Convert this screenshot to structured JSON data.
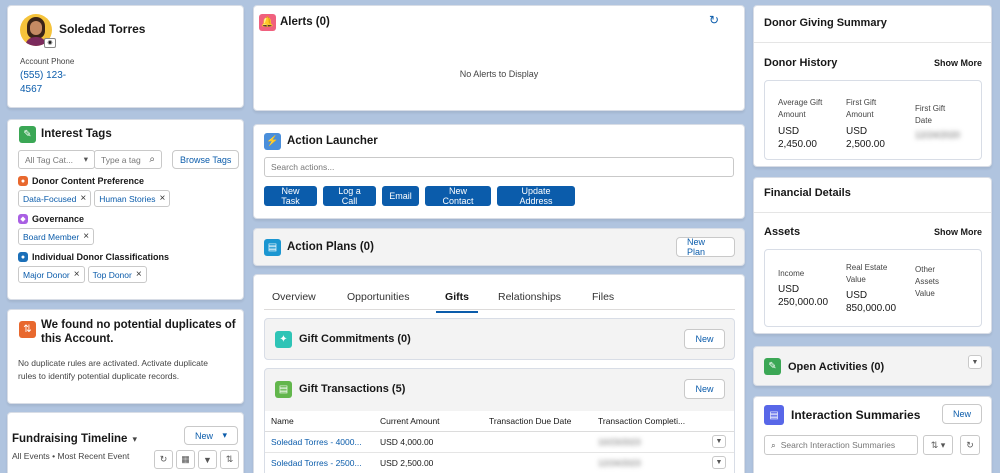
{
  "profile": {
    "name": "Soledad Torres",
    "phone_label": "Account Phone",
    "phone_line1": "(555) 123-",
    "phone_line2": "4567"
  },
  "interest_tags": {
    "title": "Interest Tags",
    "category_placeholder": "All Tag Cat...",
    "type_placeholder": "Type a tag",
    "browse_label": "Browse Tags",
    "groups": [
      {
        "name": "Donor Content Preference",
        "color": "#e8682e",
        "tags": [
          "Data-Focused",
          "Human Stories"
        ]
      },
      {
        "name": "Governance",
        "color": "#a960e3",
        "tags": [
          "Board Member"
        ]
      },
      {
        "name": "Individual Donor Classifications",
        "color": "#1b6fb8",
        "tags": [
          "Major Donor",
          "Top Donor"
        ]
      }
    ]
  },
  "duplicates": {
    "title_line1": "We found no potential duplicates of",
    "title_line2": "this Account.",
    "body_line1": "No duplicate rules are activated. Activate duplicate",
    "body_line2": "rules to identify potential duplicate records."
  },
  "timeline": {
    "title": "Fundraising Timeline",
    "subtitle": "All Events • Most Recent Event",
    "new_label": "New"
  },
  "alerts": {
    "title": "Alerts (0)",
    "empty": "No Alerts to Display"
  },
  "launcher": {
    "title": "Action Launcher",
    "search_placeholder": "Search actions...",
    "actions": [
      "New Task",
      "Log a Call",
      "Email",
      "New Contact",
      "Update Address"
    ]
  },
  "plans": {
    "title": "Action Plans (0)",
    "new_label": "New Plan"
  },
  "tabs": [
    "Overview",
    "Opportunities",
    "Gifts",
    "Relationships",
    "Files"
  ],
  "active_tab": "Gifts",
  "commitments": {
    "title": "Gift Commitments (0)",
    "new_label": "New"
  },
  "transactions": {
    "title": "Gift Transactions (5)",
    "new_label": "New",
    "columns": [
      "Name",
      "Current Amount",
      "Transaction Due Date",
      "Transaction Completi..."
    ],
    "rows": [
      {
        "name": "Soledad Torres - 4000...",
        "amount": "USD 4,000.00",
        "due": "",
        "completed": "10/23/2023"
      },
      {
        "name": "Soledad Torres - 2500...",
        "amount": "USD 2,500.00",
        "due": "",
        "completed": "12/24/2023"
      }
    ]
  },
  "giving_summary": {
    "title": "Donor Giving Summary"
  },
  "donor_history": {
    "title": "Donor History",
    "show_more": "Show More",
    "fields": [
      {
        "label_lines": [
          "Average Gift",
          "Amount"
        ],
        "value_lines": [
          "USD",
          "2,450.00"
        ]
      },
      {
        "label_lines": [
          "First Gift",
          "Amount"
        ],
        "value_lines": [
          "USD",
          "2,500.00"
        ]
      },
      {
        "label_lines": [
          "First Gift",
          "Date"
        ],
        "value_lines": [
          "12/24/2020"
        ]
      }
    ]
  },
  "financial": {
    "title": "Financial Details"
  },
  "assets": {
    "title": "Assets",
    "show_more": "Show More",
    "fields": [
      {
        "label_lines": [
          "Income"
        ],
        "value_lines": [
          "USD",
          "250,000.00"
        ]
      },
      {
        "label_lines": [
          "Real Estate",
          "Value"
        ],
        "value_lines": [
          "USD",
          "850,000.00"
        ]
      },
      {
        "label_lines": [
          "Other",
          "Assets",
          "Value"
        ],
        "value_lines": []
      }
    ]
  },
  "activities": {
    "title": "Open Activities (0)"
  },
  "interactions": {
    "title": "Interaction Summaries",
    "new_label": "New",
    "search_placeholder": "Search Interaction Summaries"
  },
  "colors": {
    "brand": "#0b5cab",
    "alert_icon": "#f0617e",
    "tag_icon": "#3ba755",
    "dup_icon": "#e8682e",
    "launcher_icon": "#4a8fdb",
    "plans_icon": "#1b96d1",
    "commit_icon": "#2ec4b6",
    "trans_icon": "#62b64c",
    "activities_icon": "#3ba755",
    "interactions_icon": "#5867e8"
  }
}
